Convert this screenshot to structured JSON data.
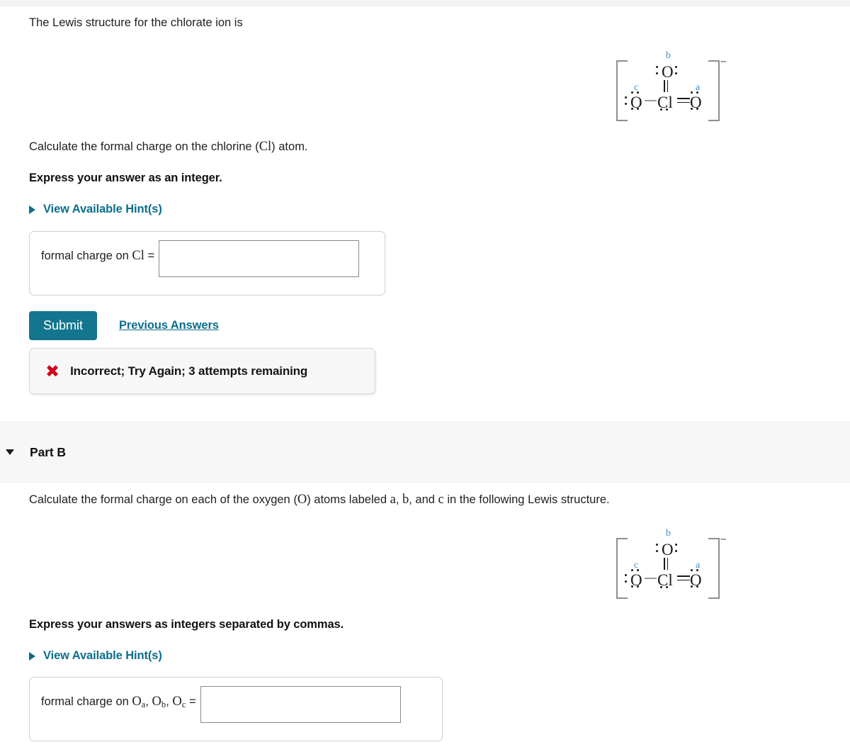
{
  "page": {
    "intro_text": "The Lewis structure for the chlorate ion is"
  },
  "part_a": {
    "question": "Calculate the formal charge on the chlorine (Cl) atom.",
    "question_prefix": "Calculate the formal charge on the chlorine (",
    "question_atom": "Cl",
    "question_suffix": ") atom.",
    "instruction": "Express your answer as an integer.",
    "hint_label": "View Available Hint(s)",
    "answer_label_prefix": "formal charge on ",
    "answer_label_atom": "Cl",
    "answer_label_equals": " =",
    "answer_value": "",
    "answer_placeholder": "",
    "submit_label": "Submit",
    "previous_answers_label": "Previous Answers",
    "feedback_icon": "x-mark-icon",
    "feedback_text": "Incorrect; Try Again; 3 attempts remaining"
  },
  "part_b": {
    "header_label": "Part B",
    "toggle_icon": "chevron-down-icon",
    "question_p1": "Calculate the formal charge on each of the oxygen (",
    "question_atom": "O",
    "question_p2": ") atoms labeled ",
    "label_a": "a",
    "comma1": ", ",
    "label_b": "b",
    "comma2": ", and ",
    "label_c": "c",
    "question_p3": " in the following Lewis structure.",
    "instruction": "Express your answers as integers separated by commas.",
    "hint_label": "View Available Hint(s)",
    "answer_label_prefix": "formal charge on ",
    "answer_label_oa": "O",
    "answer_label_oa_sub": "a",
    "answer_label_ob": "O",
    "answer_label_ob_sub": "b",
    "answer_label_oc": "O",
    "answer_label_oc_sub": "c",
    "answer_label_equals": " =",
    "answer_value": "",
    "answer_placeholder": ""
  },
  "lewis_structure": {
    "ion_charge": "–",
    "center_atom": "Cl",
    "top_atom": "O",
    "left_atom": "O",
    "right_atom": "O",
    "label_top": "b",
    "label_left": "c",
    "label_right": "a",
    "label_color": "#3f8fd0",
    "bracket_color": "#8e8e8e",
    "bond_top": "double",
    "bond_left": "single",
    "bond_right": "double"
  },
  "colors": {
    "accent_teal": "#0b6e8b",
    "submit_bg": "#14758f",
    "error_red": "#d0021b",
    "band_bg": "#f7f7f8",
    "label_blue": "#3f8fd0"
  }
}
